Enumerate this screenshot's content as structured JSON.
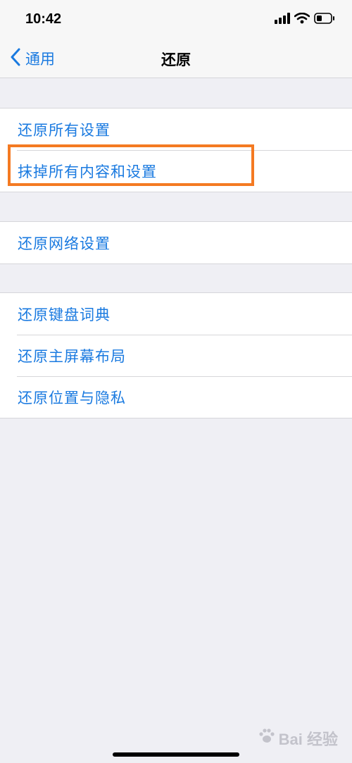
{
  "status_bar": {
    "time": "10:42"
  },
  "nav": {
    "back_label": "通用",
    "title": "还原"
  },
  "groups": [
    {
      "items": [
        {
          "label": "还原所有设置"
        },
        {
          "label": "抹掉所有内容和设置"
        }
      ]
    },
    {
      "items": [
        {
          "label": "还原网络设置"
        }
      ]
    },
    {
      "items": [
        {
          "label": "还原键盘词典"
        },
        {
          "label": "还原主屏幕布局"
        },
        {
          "label": "还原位置与隐私"
        }
      ]
    }
  ],
  "watermark": {
    "text": "Bai 经验"
  },
  "colors": {
    "accent": "#1a7ae0",
    "highlight": "#f47a22"
  }
}
